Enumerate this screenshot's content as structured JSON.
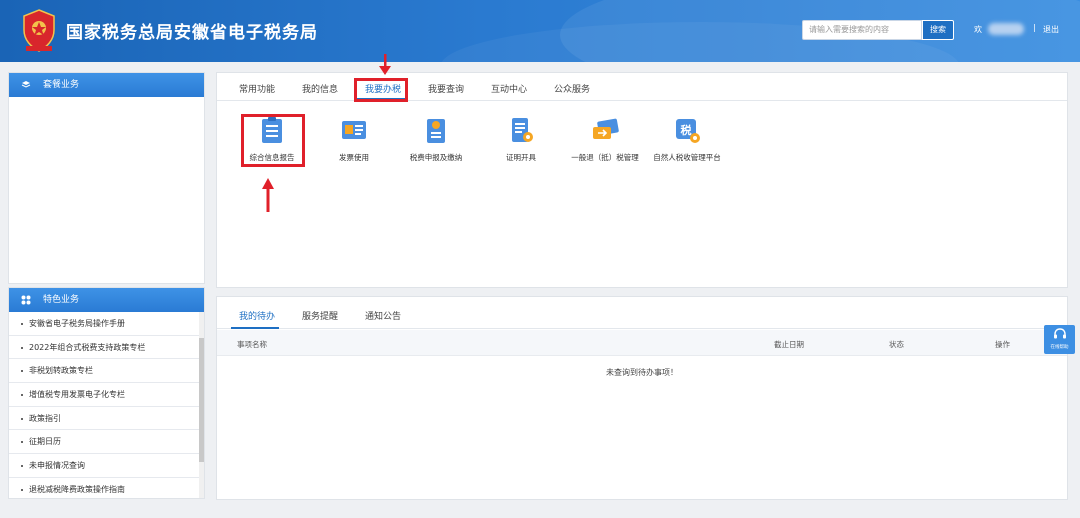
{
  "header": {
    "title": "国家税务总局安徽省电子税务局",
    "search_placeholder": "请输入需要搜索的内容",
    "search_button": "搜索",
    "welcome": "欢",
    "separator": "|",
    "logout": "退出"
  },
  "left": {
    "package_title": "套餐业务",
    "feature_title": "特色业务",
    "feature_items": [
      "安徽省电子税务局操作手册",
      "2022年组合式税费支持政策专栏",
      "非税划转政策专栏",
      "增值税专用发票电子化专栏",
      "政策指引",
      "征期日历",
      "未申报情况查询",
      "退税减税降费政策操作指南"
    ]
  },
  "tabs": [
    "常用功能",
    "我的信息",
    "我要办税",
    "我要查询",
    "互动中心",
    "公众服务"
  ],
  "functions": [
    {
      "label": "综合信息报告",
      "icon": "report-icon"
    },
    {
      "label": "发票使用",
      "icon": "invoice-icon"
    },
    {
      "label": "税费申报及缴纳",
      "icon": "declare-icon"
    },
    {
      "label": "证明开具",
      "icon": "certificate-icon"
    },
    {
      "label": "一般退（抵）税管理",
      "icon": "refund-icon"
    },
    {
      "label": "自然人税收管理平台",
      "icon": "tax-platform-icon"
    }
  ],
  "bottom_tabs": [
    "我的待办",
    "服务提醒",
    "通知公告"
  ],
  "table": {
    "headers": [
      "事项名称",
      "截止日期",
      "状态",
      "操作"
    ],
    "empty_text": "未查询到待办事项！"
  },
  "float": {
    "label": "在线帮助"
  },
  "colors": {
    "header": "#1a64b6",
    "accent": "#1e6fc3",
    "highlight": "#e0202a"
  }
}
